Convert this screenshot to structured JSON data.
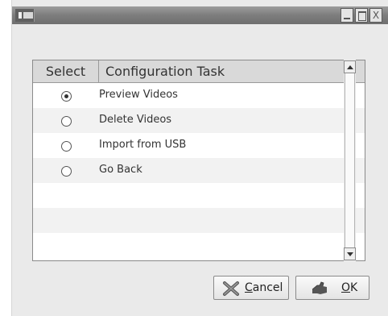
{
  "window": {
    "title": "",
    "controls": {
      "minimize_icon": "minimize-icon",
      "maximize_icon": "maximize-icon",
      "close_glyph": "X"
    }
  },
  "table": {
    "columns": [
      "Select",
      "Configuration Task"
    ],
    "rows": [
      {
        "label": "Preview Videos",
        "selected": true
      },
      {
        "label": "Delete Videos",
        "selected": false
      },
      {
        "label": "Import from USB",
        "selected": false
      },
      {
        "label": "Go Back",
        "selected": false
      }
    ],
    "row_stripe_color": "#f2f2f2"
  },
  "buttons": {
    "cancel": {
      "mnemonic": "C",
      "rest": "ancel",
      "icon": "cancel-icon"
    },
    "ok": {
      "mnemonic": "O",
      "rest": "K",
      "icon": "ok-icon"
    }
  }
}
